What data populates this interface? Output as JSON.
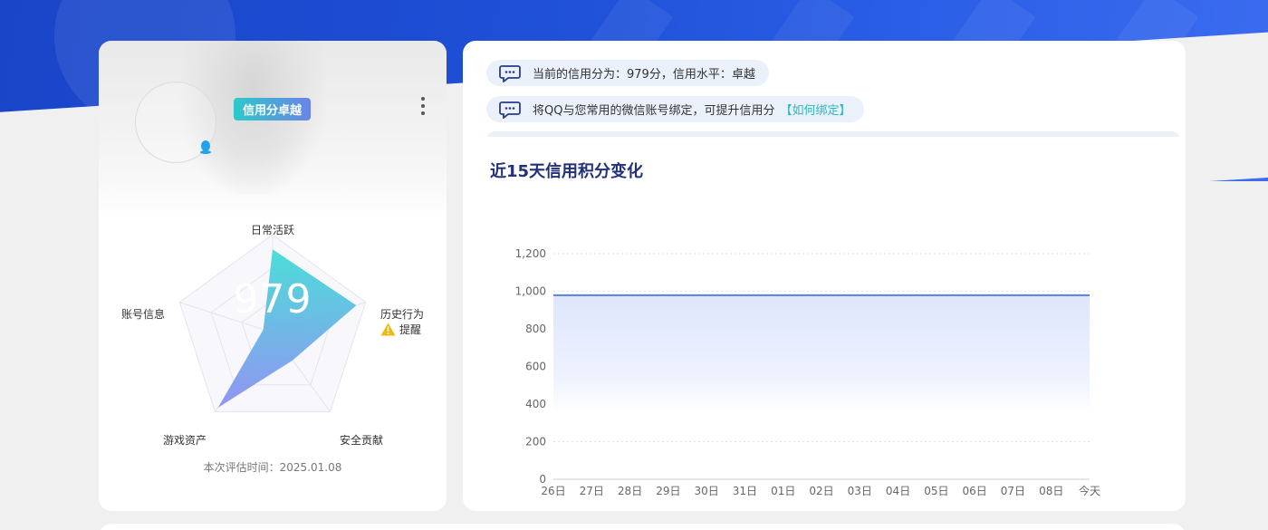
{
  "banner": {
    "colors": {
      "primary": "#1e4fd6",
      "light": "#3b6cf0"
    }
  },
  "profile": {
    "badge_label": "信用分卓越",
    "qq_icon": "qq-penguin-icon",
    "more_icon": "kebab-menu-icon"
  },
  "radar": {
    "axes": [
      "日常活跃",
      "历史行为",
      "安全贡献",
      "游戏资产",
      "账号信息"
    ],
    "values": [
      0.85,
      0.9,
      0.35,
      0.95,
      0.1
    ],
    "warning_label": "提醒",
    "score": "979",
    "eval_time": "本次评估时间：2025.01.08",
    "colors": {
      "fill_top": "#3ddbd6",
      "fill_bottom": "#7c8ef0",
      "grid": "#e3e3ef"
    }
  },
  "messages": [
    {
      "text": "当前的信用分为：979分，信用水平：卓越",
      "link": ""
    },
    {
      "text": "将QQ与您常用的微信账号绑定，可提升信用分",
      "link": "【如何绑定】"
    }
  ],
  "chart_title": "近15天信用积分变化",
  "chart_data": {
    "type": "area",
    "title": "近15天信用积分变化",
    "x": [
      "26日",
      "27日",
      "28日",
      "29日",
      "30日",
      "31日",
      "01日",
      "02日",
      "03日",
      "04日",
      "05日",
      "06日",
      "07日",
      "08日",
      "今天"
    ],
    "series": [
      {
        "values": [
          979,
          979,
          979,
          979,
          979,
          979,
          979,
          979,
          979,
          979,
          979,
          979,
          979,
          979,
          979
        ]
      }
    ],
    "y_ticks": [
      "0",
      "200",
      "400",
      "600",
      "800",
      "1,000",
      "1,200"
    ],
    "ylim": [
      0,
      1200
    ],
    "grid": true,
    "colors": {
      "line": "#5b7fe0",
      "area": "#e3e9fd"
    }
  }
}
